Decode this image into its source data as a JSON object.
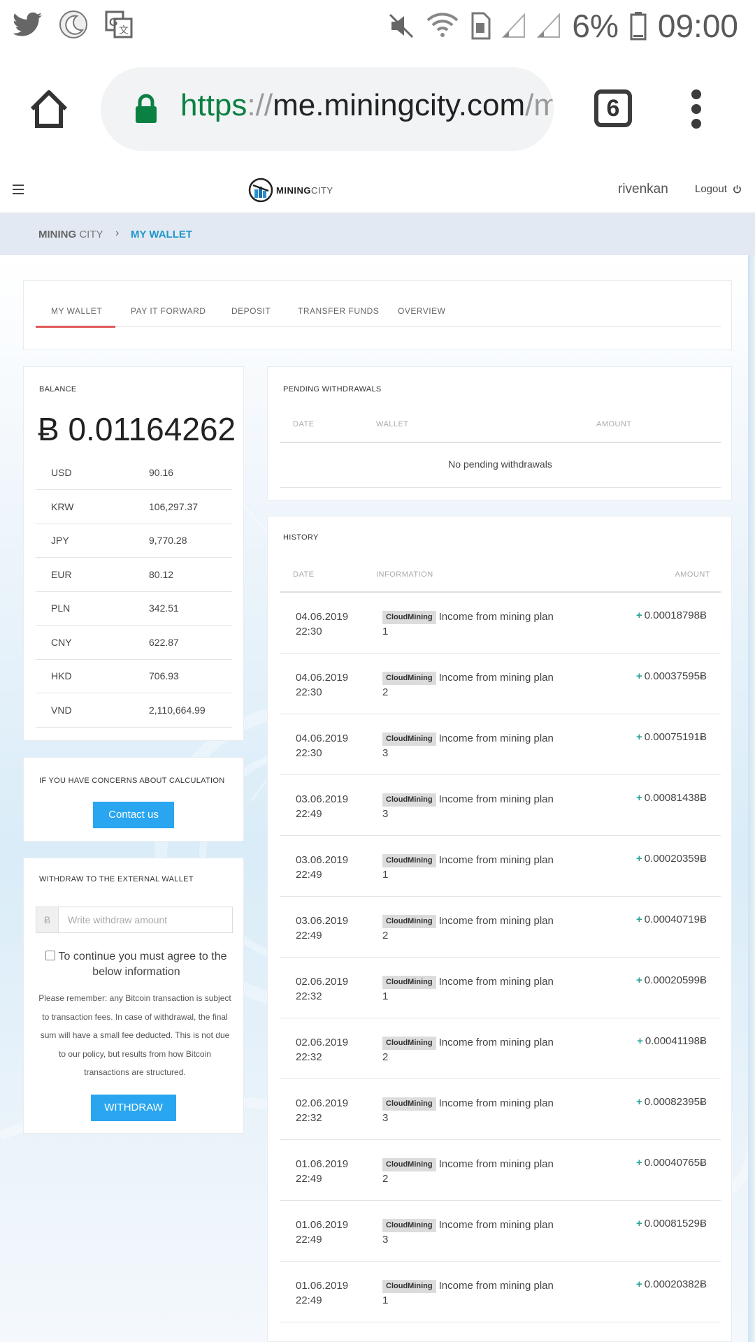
{
  "status_bar": {
    "battery": "6%",
    "time": "09:00",
    "left_icons": [
      "twitter-icon",
      "night-mode-icon",
      "translate-icon"
    ],
    "right_icons": [
      "mute-icon",
      "wifi-icon",
      "sim-icon",
      "signal-icon",
      "signal-icon",
      "battery-icon"
    ]
  },
  "browser": {
    "url_scheme": "https",
    "url_sep": "://",
    "url_host": "me.miningcity.com",
    "url_rest": "/my",
    "tab_count": "6"
  },
  "header": {
    "logo_bold": "MINING",
    "logo_thin": "CITY",
    "username": "rivenkan",
    "logout_label": "Logout"
  },
  "breadcrumb": {
    "home_bold": "MINING",
    "home_light": "CITY",
    "separator": "›",
    "current": "MY WALLET"
  },
  "tabs": [
    {
      "label": "MY WALLET",
      "active": true
    },
    {
      "label": "PAY IT FORWARD",
      "active": false
    },
    {
      "label": "DEPOSIT",
      "active": false
    },
    {
      "label": "TRANSFER FUNDS",
      "active": false
    },
    {
      "label": "OVERVIEW",
      "active": false
    }
  ],
  "balance": {
    "title": "BALANCE",
    "value": "Ƀ 0.01164262",
    "currencies": [
      {
        "code": "USD",
        "value": "90.16"
      },
      {
        "code": "KRW",
        "value": "106,297.37"
      },
      {
        "code": "JPY",
        "value": "9,770.28"
      },
      {
        "code": "EUR",
        "value": "80.12"
      },
      {
        "code": "PLN",
        "value": "342.51"
      },
      {
        "code": "CNY",
        "value": "622.87"
      },
      {
        "code": "HKD",
        "value": "706.93"
      },
      {
        "code": "VND",
        "value": "2,110,664.99"
      }
    ]
  },
  "concerns": {
    "title": "IF YOU HAVE CONCERNS ABOUT CALCULATION",
    "button": "Contact us"
  },
  "withdraw": {
    "title": "WITHDRAW TO THE EXTERNAL WALLET",
    "addon": "Ƀ",
    "placeholder": "Write withdraw amount",
    "agree_text": "To continue you must agree to the below information",
    "notice": "Please remember: any Bitcoin transaction is subject to transaction fees. In case of withdrawal, the final sum will have a small fee deducted. This is not due to our policy, but results from how Bitcoin transactions are structured.",
    "button": "WITHDRAW"
  },
  "pending": {
    "title": "PENDING WITHDRAWALS",
    "col_date": "DATE",
    "col_wallet": "WALLET",
    "col_amount": "AMOUNT",
    "empty": "No pending withdrawals"
  },
  "history": {
    "title": "HISTORY",
    "col_date": "DATE",
    "col_info": "INFORMATION",
    "col_amount": "AMOUNT",
    "rows": [
      {
        "date": "04.06.2019",
        "time": "22:30",
        "badge": "CloudMining",
        "info": "Income from mining plan 1",
        "sign": "+",
        "amount": "0.00018798Ƀ"
      },
      {
        "date": "04.06.2019",
        "time": "22:30",
        "badge": "CloudMining",
        "info": "Income from mining plan 2",
        "sign": "+",
        "amount": "0.00037595Ƀ"
      },
      {
        "date": "04.06.2019",
        "time": "22:30",
        "badge": "CloudMining",
        "info": "Income from mining plan 3",
        "sign": "+",
        "amount": "0.00075191Ƀ"
      },
      {
        "date": "03.06.2019",
        "time": "22:49",
        "badge": "CloudMining",
        "info": "Income from mining plan 3",
        "sign": "+",
        "amount": "0.00081438Ƀ"
      },
      {
        "date": "03.06.2019",
        "time": "22:49",
        "badge": "CloudMining",
        "info": "Income from mining plan 1",
        "sign": "+",
        "amount": "0.00020359Ƀ"
      },
      {
        "date": "03.06.2019",
        "time": "22:49",
        "badge": "CloudMining",
        "info": "Income from mining plan 2",
        "sign": "+",
        "amount": "0.00040719Ƀ"
      },
      {
        "date": "02.06.2019",
        "time": "22:32",
        "badge": "CloudMining",
        "info": "Income from mining plan 1",
        "sign": "+",
        "amount": "0.00020599Ƀ"
      },
      {
        "date": "02.06.2019",
        "time": "22:32",
        "badge": "CloudMining",
        "info": "Income from mining plan 2",
        "sign": "+",
        "amount": "0.00041198Ƀ"
      },
      {
        "date": "02.06.2019",
        "time": "22:32",
        "badge": "CloudMining",
        "info": "Income from mining plan 3",
        "sign": "+",
        "amount": "0.00082395Ƀ"
      },
      {
        "date": "01.06.2019",
        "time": "22:49",
        "badge": "CloudMining",
        "info": "Income from mining plan 2",
        "sign": "+",
        "amount": "0.00040765Ƀ"
      },
      {
        "date": "01.06.2019",
        "time": "22:49",
        "badge": "CloudMining",
        "info": "Income from mining plan 3",
        "sign": "+",
        "amount": "0.00081529Ƀ"
      },
      {
        "date": "01.06.2019",
        "time": "22:49",
        "badge": "CloudMining",
        "info": "Income from mining plan 1",
        "sign": "+",
        "amount": "0.00020382Ƀ"
      }
    ]
  },
  "colors": {
    "accent_blue": "#29a6ef",
    "active_tab": "#e05a5a",
    "breadcrumb_current": "#2196c9",
    "positive": "#2aa39a",
    "lock_green": "#0b8043"
  }
}
